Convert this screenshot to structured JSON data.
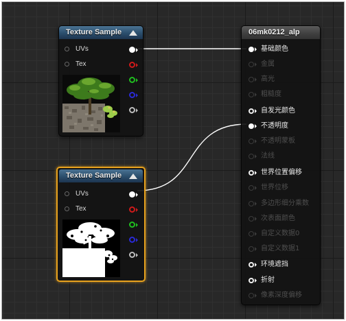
{
  "texture_node_1": {
    "title": "Texture Sample",
    "inputs": [
      {
        "label": "UVs"
      },
      {
        "label": "Tex"
      }
    ],
    "output_colors": [
      "#ffffff",
      "#d01a1a",
      "#1fbf1f",
      "#2a2ad8",
      "#bdbdbd"
    ]
  },
  "texture_node_2": {
    "title": "Texture Sample",
    "inputs": [
      {
        "label": "UVs"
      },
      {
        "label": "Tex"
      }
    ],
    "output_colors": [
      "#ffffff",
      "#d01a1a",
      "#1fbf1f",
      "#2a2ad8",
      "#bdbdbd"
    ]
  },
  "material_node": {
    "title": "06mk0212_alp",
    "pins": [
      {
        "label": "基础颜色",
        "active": true
      },
      {
        "label": "金属",
        "active": false
      },
      {
        "label": "高光",
        "active": false
      },
      {
        "label": "粗糙度",
        "active": false
      },
      {
        "label": "自发光颜色",
        "active": true
      },
      {
        "label": "不透明度",
        "active": true
      },
      {
        "label": "不透明蒙板",
        "active": false
      },
      {
        "label": "法线",
        "active": false
      },
      {
        "label": "世界位置偏移",
        "active": true
      },
      {
        "label": "世界位移",
        "active": false
      },
      {
        "label": "多边形细分乘数",
        "active": false
      },
      {
        "label": "次表面颜色",
        "active": false
      },
      {
        "label": "自定义数据0",
        "active": false
      },
      {
        "label": "自定义数据1",
        "active": false
      },
      {
        "label": "环境遮挡",
        "active": true
      },
      {
        "label": "折射",
        "active": true
      },
      {
        "label": "像素深度偏移",
        "active": false
      }
    ]
  },
  "colors": {
    "canvas_bg": "#282828",
    "selection_outline": "#e8a21e",
    "texture_header": "#2b4e6c",
    "material_header": "#3f3f3f",
    "wire": "#ffffff"
  }
}
